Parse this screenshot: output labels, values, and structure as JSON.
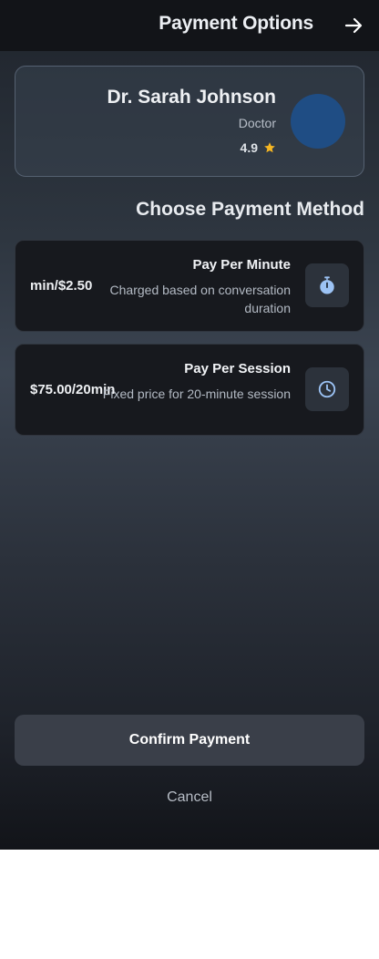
{
  "header": {
    "title": "Payment Options",
    "back_icon": "arrow-right-icon"
  },
  "doctor": {
    "name": "Dr. Sarah Johnson",
    "role": "Doctor",
    "rating": "4.9",
    "rating_icon": "star-icon",
    "avatar_color": "#1f4d84"
  },
  "section": {
    "title": "Choose Payment Method"
  },
  "payment_options": [
    {
      "price": "min/$2.50",
      "title": "Pay Per Minute",
      "description": "Charged based on conversation duration",
      "icon": "stopwatch-icon"
    },
    {
      "price": "$75.00/20min",
      "title": "Pay Per Session",
      "description": "Fixed price for 20-minute session",
      "icon": "clock-icon"
    }
  ],
  "actions": {
    "confirm_label": "Confirm Payment",
    "cancel_label": "Cancel"
  },
  "colors": {
    "accent_icon": "#9cc3f5",
    "star": "#f5b623",
    "card_background": "#17191e",
    "header_background": "#121418"
  }
}
